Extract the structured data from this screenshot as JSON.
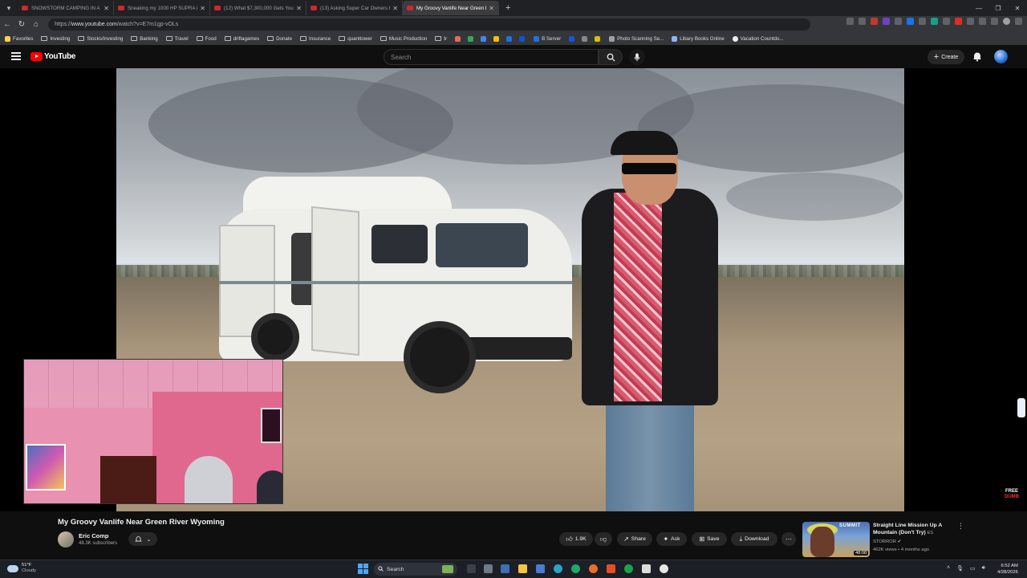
{
  "browser": {
    "tabs": [
      {
        "title": "SNOWSTORM CAMPING IN A VA"
      },
      {
        "title": "Sneaking my 1000 HP SUPRA int"
      },
      {
        "title": "(12) What $7,300,000 Gets You in"
      },
      {
        "title": "(13) Asking Super Car Owners Ho"
      },
      {
        "title": "My Groovy Vanlife Near Green Ri"
      }
    ],
    "url_prefix": "https://",
    "url_host": "www.youtube.com",
    "url_path": "/watch?v=E7m1gp-vOLs",
    "bookmarks": [
      "Favorites",
      "Investing",
      "Stocks/Investing",
      "Banking",
      "Travel",
      "Food",
      "driftagames",
      "Donate",
      "Insurance",
      "quanttower",
      "Music Production",
      "tr"
    ],
    "bookmarks_right": [
      "B Server",
      "Photo Scanning Se...",
      "Libary Books Online",
      "Vacation Countdo..."
    ]
  },
  "youtube": {
    "logo_text": "YouTube",
    "search_placeholder": "Search",
    "create_label": "Create"
  },
  "video": {
    "title": "My Groovy Vanlife Near Green River Wyoming",
    "channel": "Eric Comp",
    "subscribers": "48.3K subscribers",
    "likes": "1.9K",
    "share_label": "Share",
    "ask_label": "Ask",
    "save_label": "Save",
    "download_label": "Download",
    "watermark_line1": "FREE",
    "watermark_line2": "DUMB"
  },
  "recommendation": {
    "title": "Straight Line Mission Up A Mountain (Don't Try)",
    "title_suffix": "ES",
    "channel": "STORROR",
    "views_age": "462K views • 4 months ago",
    "duration": "48:08",
    "thumb_text": "SUMMIT"
  },
  "taskbar": {
    "temp": "51°F",
    "condition": "Cloudy",
    "search_label": "Search",
    "time": "6:52 AM",
    "date": "4/28/2026"
  }
}
